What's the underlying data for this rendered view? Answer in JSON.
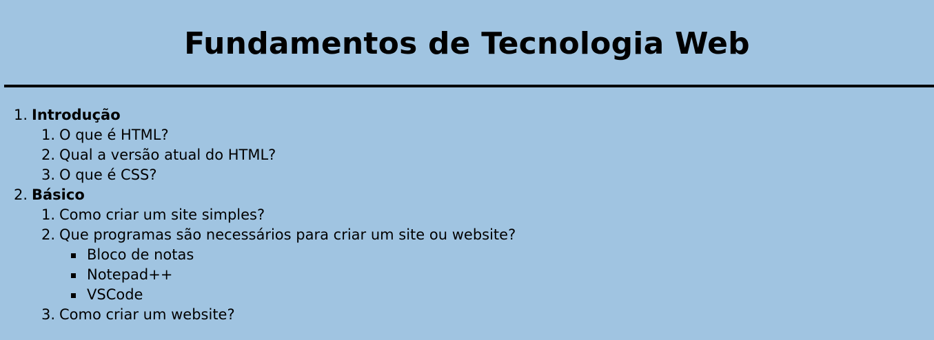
{
  "header": {
    "title": "Fundamentos de Tecnologia Web"
  },
  "topics": [
    {
      "number": "1.",
      "label": "Introdução",
      "items": [
        {
          "number": "1.",
          "label": "O que é HTML?"
        },
        {
          "number": "2.",
          "label": "Qual a versão atual do HTML?"
        },
        {
          "number": "3.",
          "label": "O que é CSS?"
        }
      ]
    },
    {
      "number": "2.",
      "label": "Básico",
      "items": [
        {
          "number": "1.",
          "label": "Como criar um site simples?"
        },
        {
          "number": "2.",
          "label": "Que programas são necessários para criar um site ou website?",
          "bullets": [
            "Bloco de notas",
            "Notepad++",
            "VSCode"
          ]
        },
        {
          "number": "3.",
          "label": "Como criar um website?"
        }
      ]
    }
  ],
  "colors": {
    "background": "#a0c4e1",
    "text": "#000000",
    "rule": "#000000"
  }
}
